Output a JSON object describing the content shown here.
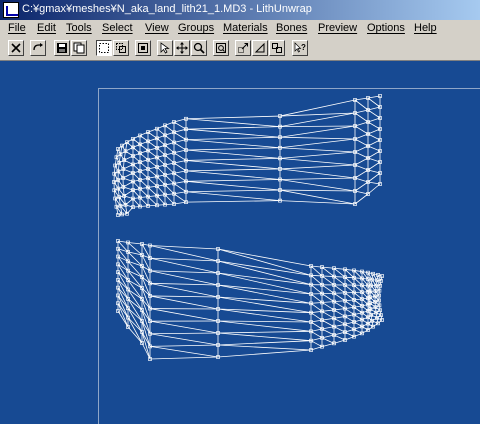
{
  "window": {
    "title": "C:¥gmax¥meshes¥N_aka_land_lith21_1.MD3 - LithUnwrap"
  },
  "menu": {
    "items": [
      "File",
      "Edit",
      "Tools",
      "Select",
      "View",
      "Groups",
      "Materials",
      "Bones",
      "Preview",
      "Options",
      "Help"
    ]
  },
  "toolbar": {
    "buttons": [
      "close-icon",
      "rotate-icon",
      "save-icon",
      "copy-icon",
      "select-rect-icon",
      "select-add-icon",
      "select-mode-icon",
      "pointer-icon",
      "move-icon",
      "zoom-icon",
      "fit-icon",
      "scale-icon",
      "rotate-sel-icon",
      "mirror-icon",
      "help-pointer-icon"
    ]
  },
  "colors": {
    "viewport_bg": "#174a93",
    "mesh_line": "#ffffff"
  }
}
